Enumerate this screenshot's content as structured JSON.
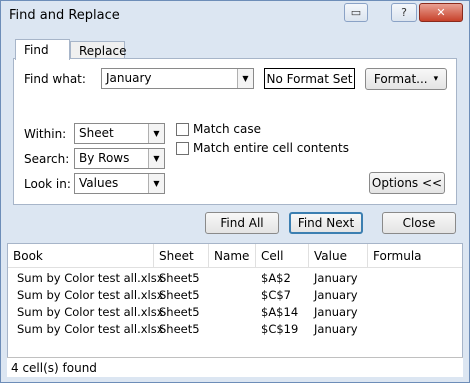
{
  "window": {
    "title": "Find and Replace",
    "tb_restore": "▭",
    "tb_help": "?",
    "tb_close": "✕"
  },
  "tabs": [
    {
      "label": "Find",
      "active": true
    },
    {
      "label": "Replace",
      "active": false
    }
  ],
  "find": {
    "label": "Find what:",
    "value": "January",
    "format_status": "No Format Set",
    "format_button": "Format...",
    "format_caret": "▾"
  },
  "options": {
    "within": {
      "label": "Within:",
      "value": "Sheet"
    },
    "search": {
      "label": "Search:",
      "value": "By Rows"
    },
    "look_in": {
      "label": "Look in:",
      "value": "Values"
    },
    "match_case": {
      "label": "Match case",
      "checked": false
    },
    "match_entire": {
      "label": "Match entire cell contents",
      "checked": false
    },
    "options_button": "Options <<"
  },
  "dropdown_arrow": "▼",
  "buttons": {
    "find_all": "Find All",
    "find_next": "Find Next",
    "close": "Close"
  },
  "results": {
    "columns": [
      "Book",
      "Sheet",
      "Name",
      "Cell",
      "Value",
      "Formula"
    ],
    "rows": [
      {
        "book": "Sum by Color test all.xlsx",
        "sheet": "Sheet5",
        "name": "",
        "cell": "$A$2",
        "value": "January",
        "formula": ""
      },
      {
        "book": "Sum by Color test all.xlsx",
        "sheet": "Sheet5",
        "name": "",
        "cell": "$C$7",
        "value": "January",
        "formula": ""
      },
      {
        "book": "Sum by Color test all.xlsx",
        "sheet": "Sheet5",
        "name": "",
        "cell": "$A$14",
        "value": "January",
        "formula": ""
      },
      {
        "book": "Sum by Color test all.xlsx",
        "sheet": "Sheet5",
        "name": "",
        "cell": "$C$19",
        "value": "January",
        "formula": ""
      }
    ]
  },
  "status": "4 cell(s) found"
}
